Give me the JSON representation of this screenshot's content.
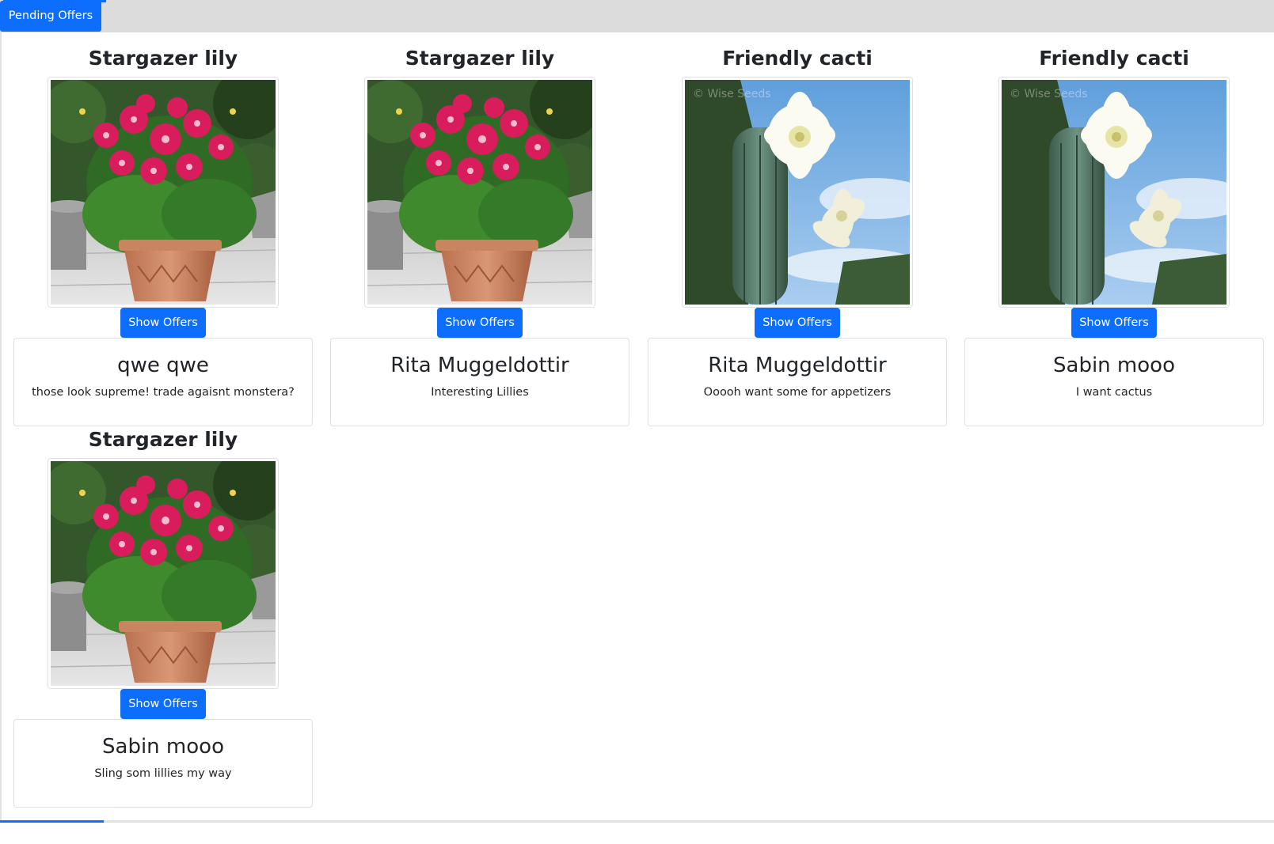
{
  "tabs": {
    "active_label": "Pending Offers"
  },
  "offers": [
    {
      "plant": "Stargazer lily",
      "image": "lily-photo",
      "button": "Show Offers",
      "offer_user": "qwe qwe",
      "offer_message": "those look supreme! trade agaisnt monstera?"
    },
    {
      "plant": "Stargazer lily",
      "image": "lily-photo",
      "button": "Show Offers",
      "offer_user": "Rita Muggeldottir",
      "offer_message": "Interesting Lillies"
    },
    {
      "plant": "Friendly cacti",
      "image": "cactus-photo",
      "button": "Show Offers",
      "offer_user": "Rita Muggeldottir",
      "offer_message": "Ooooh want some for appetizers"
    },
    {
      "plant": "Friendly cacti",
      "image": "cactus-photo",
      "button": "Show Offers",
      "offer_user": "Sabin mooo",
      "offer_message": "I want cactus"
    },
    {
      "plant": "Stargazer lily",
      "image": "lily-photo",
      "button": "Show Offers",
      "offer_user": "Sabin mooo",
      "offer_message": "Sling som lillies my way"
    }
  ],
  "colors": {
    "primary": "#0d6efd",
    "tab_bar": "#dcdcdc",
    "border": "#dee2e6",
    "text": "#212529"
  }
}
